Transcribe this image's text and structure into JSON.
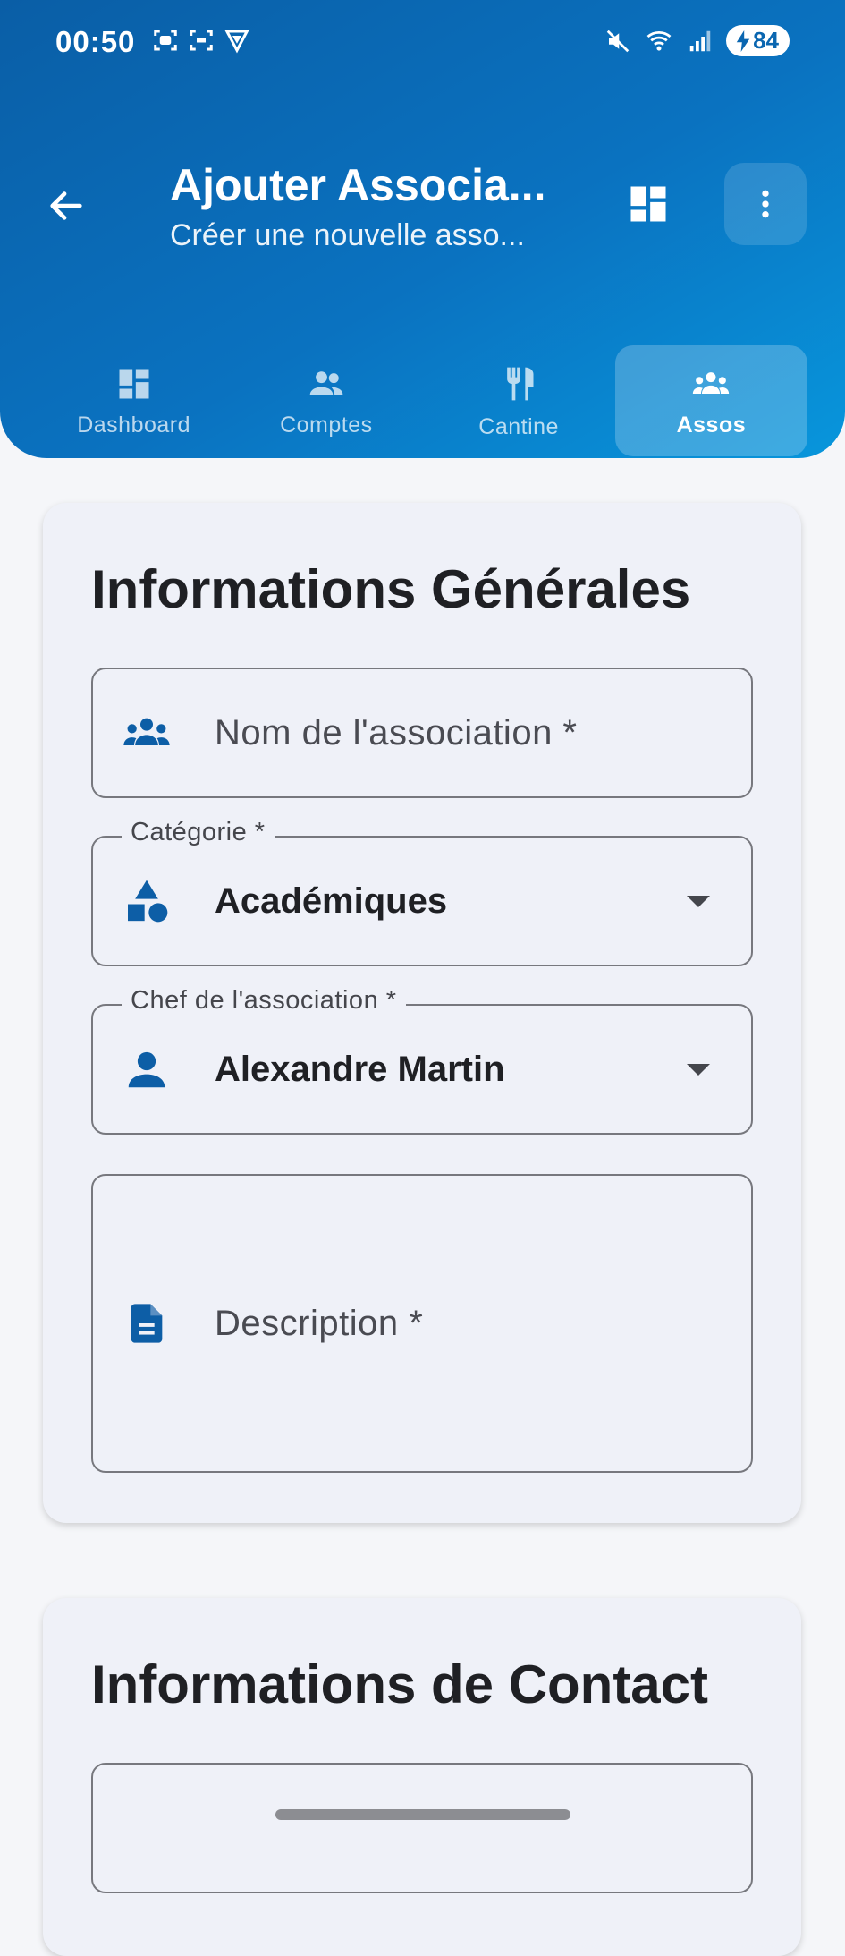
{
  "status_bar": {
    "time": "00:50",
    "battery": "84"
  },
  "app_bar": {
    "title": "Ajouter Associa...",
    "subtitle": "Créer une nouvelle asso..."
  },
  "tabs": [
    {
      "label": "Dashboard",
      "icon": "dashboard-icon",
      "active": false
    },
    {
      "label": "Comptes",
      "icon": "people-icon",
      "active": false
    },
    {
      "label": "Cantine",
      "icon": "restaurant-icon",
      "active": false
    },
    {
      "label": "Assos",
      "icon": "groups-icon",
      "active": true
    }
  ],
  "general_section": {
    "title": "Informations Générales",
    "name_field": {
      "placeholder": "Nom de l'association *",
      "icon": "groups-icon"
    },
    "category_field": {
      "label": "Catégorie *",
      "value": "Académiques",
      "icon": "category-icon"
    },
    "chief_field": {
      "label": "Chef de l'association *",
      "value": "Alexandre Martin",
      "icon": "person-icon"
    },
    "description_field": {
      "placeholder": "Description *",
      "icon": "description-icon"
    }
  },
  "contact_section": {
    "title": "Informations de Contact"
  },
  "colors": {
    "header_start": "#0a5ea6",
    "header_end": "#0896dc",
    "icon_blue": "#0d5ea6",
    "card_bg": "#eff1f8",
    "page_bg": "#f5f6f9"
  }
}
